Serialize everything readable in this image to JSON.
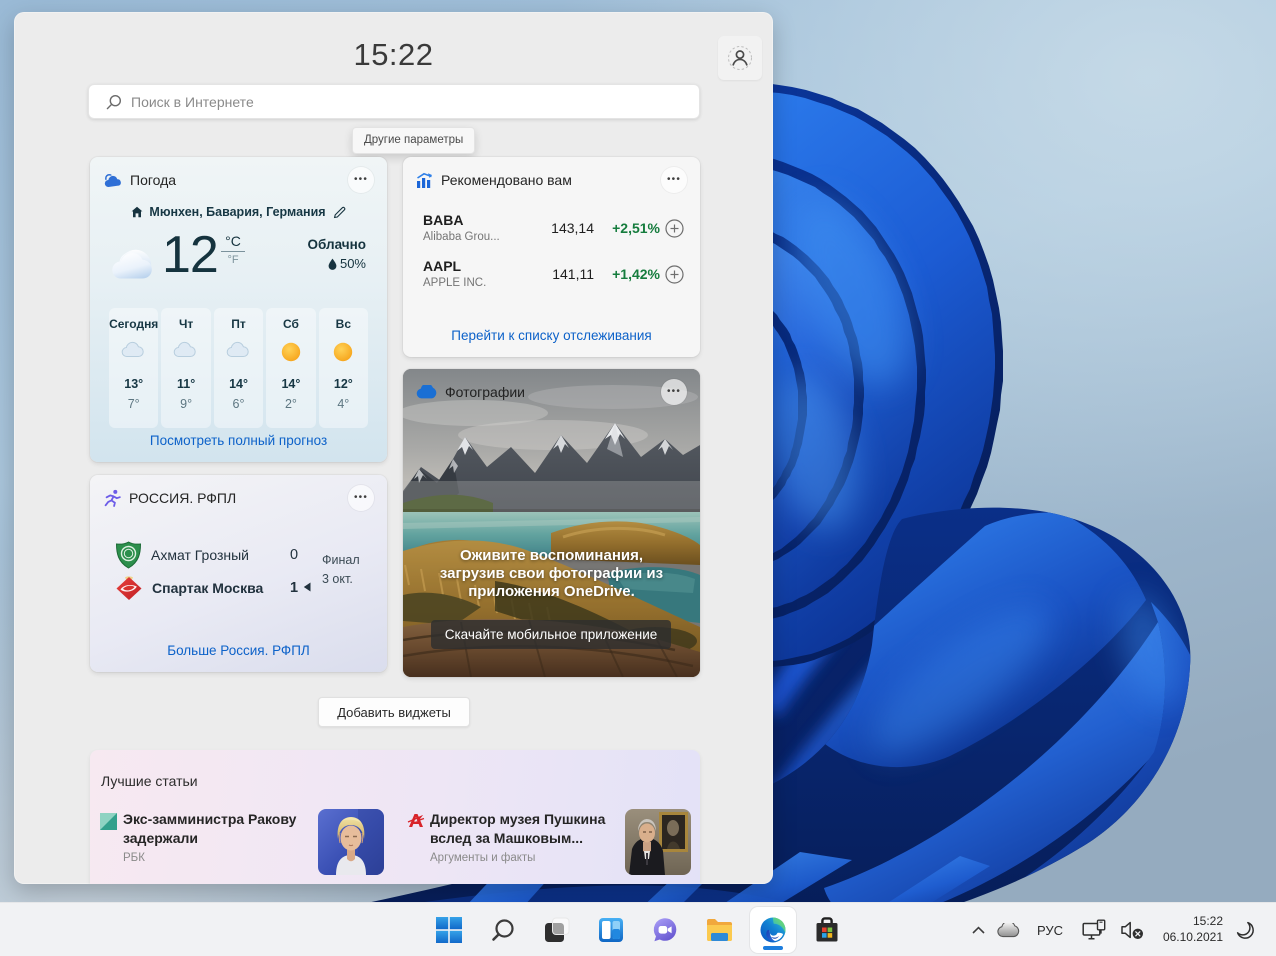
{
  "panel": {
    "time": "15:22",
    "search_placeholder": "Поиск в Интернете",
    "tooltip": "Другие параметры",
    "add_widgets_label": "Добавить виджеты"
  },
  "weather": {
    "title": "Погода",
    "location": "Мюнхен, Бавария, Германия",
    "temp": "12",
    "unit_c": "°C",
    "unit_f": "°F",
    "condition": "Облачно",
    "precipitation": "50%",
    "forecast": [
      {
        "day": "Сегодня",
        "icon": "cloudy",
        "high": "13°",
        "low": "7°"
      },
      {
        "day": "Чт",
        "icon": "cloudy",
        "high": "11°",
        "low": "9°"
      },
      {
        "day": "Пт",
        "icon": "cloudy",
        "high": "14°",
        "low": "6°"
      },
      {
        "day": "Сб",
        "icon": "sunny",
        "high": "14°",
        "low": "2°"
      },
      {
        "day": "Вс",
        "icon": "sunny",
        "high": "12°",
        "low": "4°"
      }
    ],
    "link": "Посмотреть полный прогноз"
  },
  "stocks": {
    "title": "Рекомендовано вам",
    "rows": [
      {
        "ticker": "BABA",
        "name": "Alibaba Grou...",
        "price": "143,14",
        "change": "+2,51%"
      },
      {
        "ticker": "AAPL",
        "name": "APPLE INC.",
        "price": "141,11",
        "change": "+1,42%"
      }
    ],
    "link": "Перейти к списку отслеживания",
    "change_color": "#157c3d"
  },
  "sports": {
    "title": "РОССИЯ. РФПЛ",
    "team1": "Ахмат Грозный",
    "score1": "0",
    "team2": "Спартак Москва",
    "score2": "1",
    "status": "Финал",
    "date": "3 окт.",
    "link": "Больше Россия. РФПЛ"
  },
  "photos": {
    "title": "Фотографии",
    "message": "Оживите воспоминания, загрузив свои фотографии из приложения OneDrive.",
    "message_line1": "Оживите воспоминания,",
    "message_line2": "загрузив свои фотографии из",
    "message_line3": "приложения OneDrive.",
    "button": "Скачайте мобильное приложение"
  },
  "news": {
    "header": "Лучшие статьи",
    "articles": [
      {
        "title": "Экс-замминистра Ракову задержали",
        "source": "РБК"
      },
      {
        "title": "Директор музея Пушкина вслед за Машковым...",
        "source": "Аргументы и факты"
      }
    ]
  },
  "taskbar": {
    "language": "РУС",
    "time": "15:22",
    "date": "06.10.2021",
    "accent": "#1d7ddd"
  }
}
